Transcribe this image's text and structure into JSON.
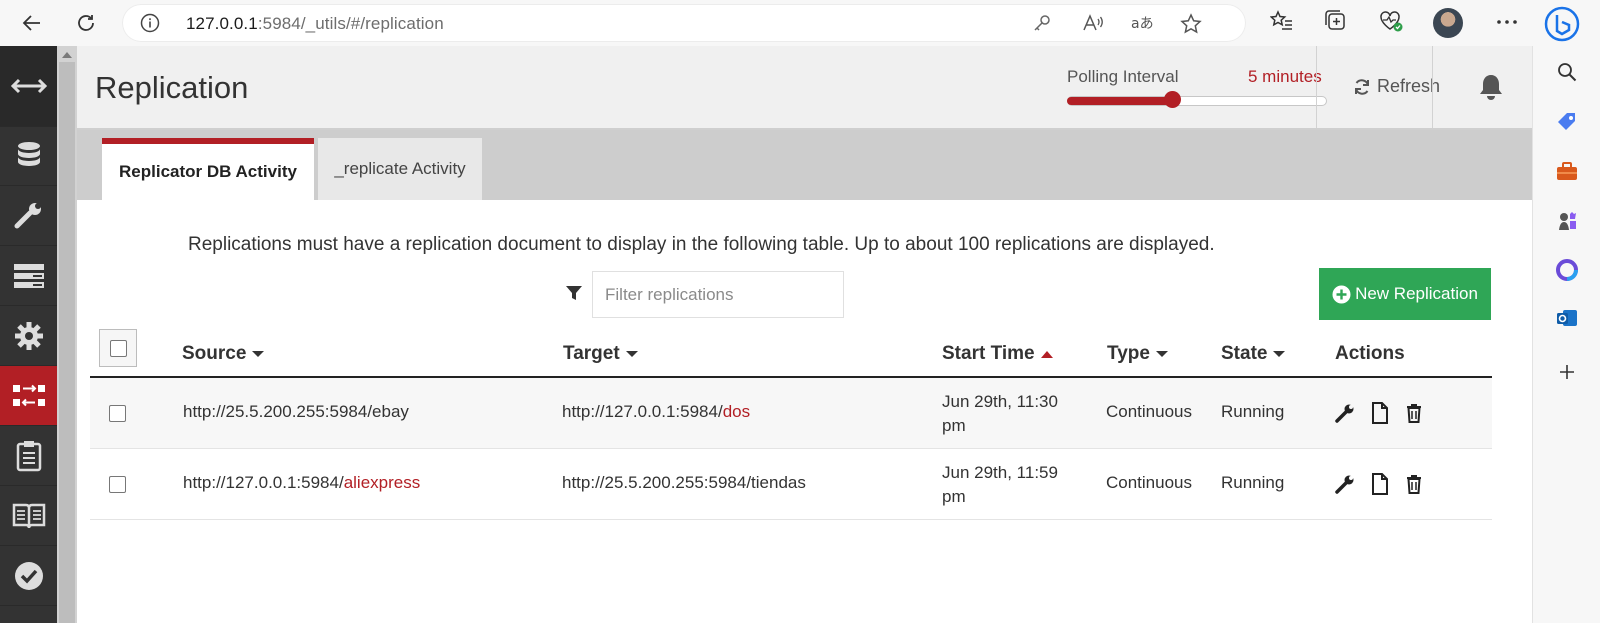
{
  "browser": {
    "url_host": "127.0.0.1",
    "url_rest": ":5984/_utils/#/replication"
  },
  "header": {
    "title": "Replication",
    "polling_label": "Polling Interval",
    "polling_value": "5 minutes",
    "polling_level_fraction": 0.41,
    "refresh_label": "Refresh"
  },
  "tabs": [
    {
      "label": "Replicator DB Activity",
      "active": true
    },
    {
      "label": "_replicate Activity",
      "active": false
    }
  ],
  "info_text": "Replications must have a replication document to display in the following table. Up to about 100 replications are displayed.",
  "filter": {
    "placeholder": "Filter replications"
  },
  "new_replication_label": "New Replication",
  "table": {
    "columns": [
      "Source",
      "Target",
      "Start Time",
      "Type",
      "State",
      "Actions"
    ],
    "rows": [
      {
        "source_prefix": "http://25.5.200.255:5984/ebay",
        "source_db": "",
        "target_prefix": "http://127.0.0.1:5984/",
        "target_db": "dos",
        "start_line1": "Jun 29th, 11:30",
        "start_line2": "pm",
        "type": "Continuous",
        "state": "Running"
      },
      {
        "source_prefix": "http://127.0.0.1:5984/",
        "source_db": "aliexpress",
        "target_prefix": "http://25.5.200.255:5984/tiendas",
        "target_db": "",
        "start_line1": "Jun 29th, 11:59",
        "start_line2": "pm",
        "type": "Continuous",
        "state": "Running"
      }
    ]
  },
  "colors": {
    "accent": "#b21f25",
    "success": "#2fa656",
    "nav_bg": "#333333"
  }
}
